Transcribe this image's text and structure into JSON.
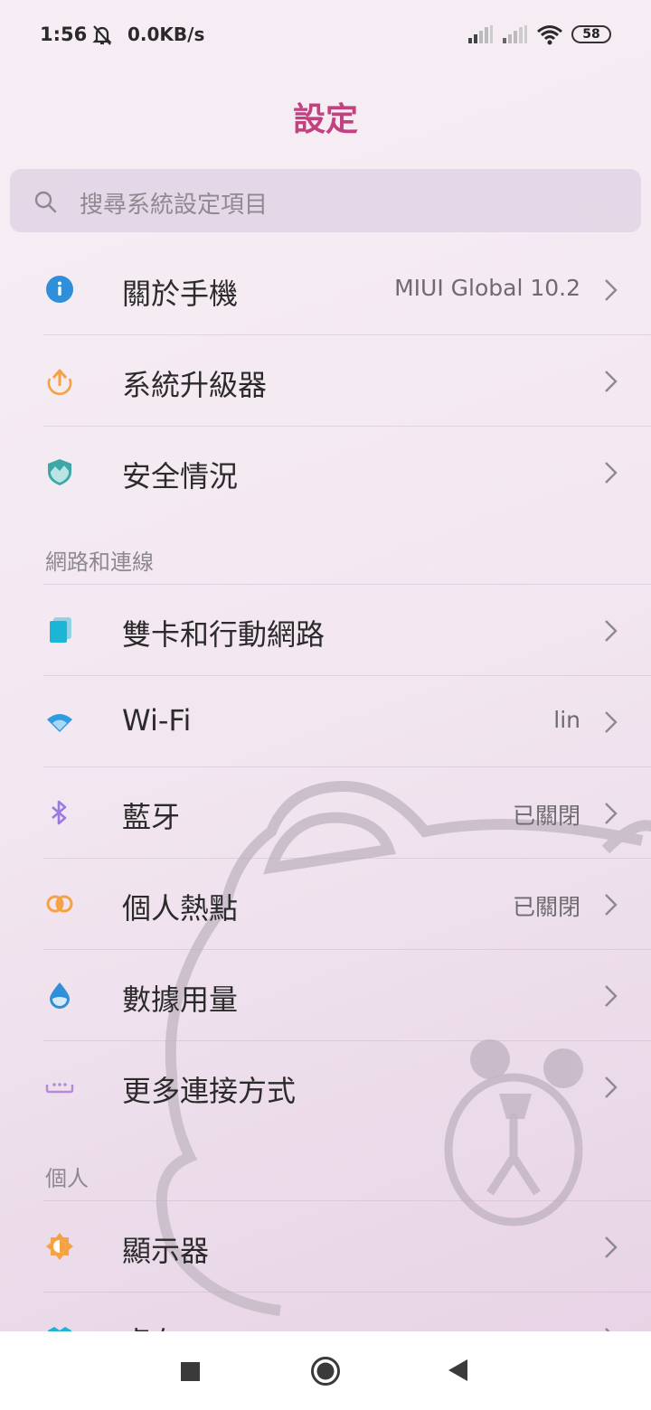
{
  "status_bar": {
    "time": "1:56",
    "net_speed": "0.0KB/s",
    "battery": "58",
    "icons": [
      "notifications-muted-icon",
      "signal-icon",
      "signal-icon",
      "wifi-icon",
      "battery-icon"
    ]
  },
  "header": {
    "title": "設定"
  },
  "search": {
    "placeholder": "搜尋系統設定項目"
  },
  "rows_top": [
    {
      "label": "關於手機",
      "value": "MIUI Global 10.2",
      "icon": "info-icon",
      "color": "#2f8fd8"
    },
    {
      "label": "系統升級器",
      "value": "",
      "icon": "upgrade-arrow-icon",
      "color": "#f5a244"
    },
    {
      "label": "安全情況",
      "value": "",
      "icon": "security-shield-icon",
      "color": "#3ea7a7"
    }
  ],
  "sections": {
    "network": "網路和連線",
    "personal": "個人"
  },
  "rows_network": [
    {
      "label": "雙卡和行動網路",
      "value": "",
      "icon": "sim-card-icon",
      "color": "#1cb5d6"
    },
    {
      "label": "Wi-Fi",
      "value": "lin",
      "icon": "wifi-icon",
      "color": "#2f9be0"
    },
    {
      "label": "藍牙",
      "value": "已關閉",
      "icon": "bluetooth-icon",
      "color": "#9a7ae0"
    },
    {
      "label": "個人熱點",
      "value": "已關閉",
      "icon": "hotspot-icon",
      "color": "#f5a244"
    },
    {
      "label": "數據用量",
      "value": "",
      "icon": "data-usage-drop-icon",
      "color": "#2f8fd8"
    },
    {
      "label": "更多連接方式",
      "value": "",
      "icon": "more-connections-icon",
      "color": "#b58ad8"
    }
  ],
  "rows_personal": [
    {
      "label": "顯示器",
      "value": "",
      "icon": "display-brightness-icon",
      "color": "#f5a244"
    },
    {
      "label": "桌布",
      "value": "",
      "icon": "wallpaper-icon",
      "color": "#1cb5d6"
    }
  ],
  "nav": {
    "buttons": [
      "recents-button",
      "home-button",
      "back-button"
    ]
  }
}
